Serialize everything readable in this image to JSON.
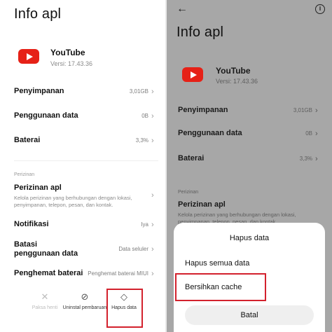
{
  "left": {
    "title": "Info apl",
    "app": {
      "name": "YouTube",
      "version": "Versi: 17.43.36"
    },
    "rows": [
      {
        "label": "Penyimpanan",
        "value": "3,01GB"
      },
      {
        "label": "Penggunaan data",
        "value": "0B"
      },
      {
        "label": "Baterai",
        "value": "3,3%"
      }
    ],
    "section": "Perizinan",
    "permissions": {
      "label": "Perizinan apl",
      "desc": "Kelola perizinan yang berhubungan dengan lokasi, penyimpanan, telepon, pesan, dan kontak."
    },
    "notif": {
      "label": "Notifikasi",
      "value": "Iya"
    },
    "limit": {
      "label": "Batasi penggunaan data",
      "value": "Data seluler"
    },
    "battery_saver": {
      "label": "Penghemat baterai",
      "value": "Penghemat baterai MIUI"
    },
    "bottom": {
      "force_stop": "Paksa henti",
      "uninstall": "Uninstal pembaruan",
      "clear_data": "Hapus data"
    }
  },
  "right": {
    "title": "Info apl",
    "app": {
      "name": "YouTube",
      "version": "Versi: 17.43.36"
    },
    "rows": [
      {
        "label": "Penyimpanan",
        "value": "3,01GB"
      },
      {
        "label": "Penggunaan data",
        "value": "0B"
      },
      {
        "label": "Baterai",
        "value": "3,3%"
      }
    ],
    "section": "Perizinan",
    "permissions": {
      "label": "Perizinan apl",
      "desc": "Kelola perizinan yang berhubungan dengan lokasi, penyimpanan, telepon, pesan, dan kontak."
    },
    "sheet": {
      "title": "Hapus data",
      "option_all": "Hapus semua data",
      "option_cache": "Bersihkan cache",
      "cancel": "Batal"
    }
  },
  "colors": {
    "highlight": "#d3212d",
    "youtube": "#e62117",
    "overlay": "#a7a7a7"
  }
}
